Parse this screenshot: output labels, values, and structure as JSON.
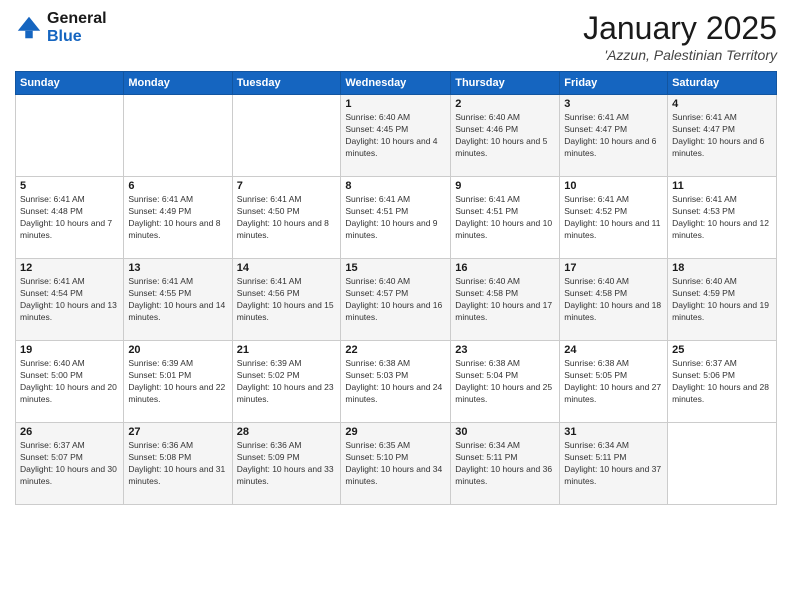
{
  "logo": {
    "line1": "General",
    "line2": "Blue"
  },
  "title": "January 2025",
  "location": "'Azzun, Palestinian Territory",
  "weekdays": [
    "Sunday",
    "Monday",
    "Tuesday",
    "Wednesday",
    "Thursday",
    "Friday",
    "Saturday"
  ],
  "weeks": [
    [
      {
        "day": "",
        "sunrise": "",
        "sunset": "",
        "daylight": ""
      },
      {
        "day": "",
        "sunrise": "",
        "sunset": "",
        "daylight": ""
      },
      {
        "day": "",
        "sunrise": "",
        "sunset": "",
        "daylight": ""
      },
      {
        "day": "1",
        "sunrise": "Sunrise: 6:40 AM",
        "sunset": "Sunset: 4:45 PM",
        "daylight": "Daylight: 10 hours and 4 minutes."
      },
      {
        "day": "2",
        "sunrise": "Sunrise: 6:40 AM",
        "sunset": "Sunset: 4:46 PM",
        "daylight": "Daylight: 10 hours and 5 minutes."
      },
      {
        "day": "3",
        "sunrise": "Sunrise: 6:41 AM",
        "sunset": "Sunset: 4:47 PM",
        "daylight": "Daylight: 10 hours and 6 minutes."
      },
      {
        "day": "4",
        "sunrise": "Sunrise: 6:41 AM",
        "sunset": "Sunset: 4:47 PM",
        "daylight": "Daylight: 10 hours and 6 minutes."
      }
    ],
    [
      {
        "day": "5",
        "sunrise": "Sunrise: 6:41 AM",
        "sunset": "Sunset: 4:48 PM",
        "daylight": "Daylight: 10 hours and 7 minutes."
      },
      {
        "day": "6",
        "sunrise": "Sunrise: 6:41 AM",
        "sunset": "Sunset: 4:49 PM",
        "daylight": "Daylight: 10 hours and 8 minutes."
      },
      {
        "day": "7",
        "sunrise": "Sunrise: 6:41 AM",
        "sunset": "Sunset: 4:50 PM",
        "daylight": "Daylight: 10 hours and 8 minutes."
      },
      {
        "day": "8",
        "sunrise": "Sunrise: 6:41 AM",
        "sunset": "Sunset: 4:51 PM",
        "daylight": "Daylight: 10 hours and 9 minutes."
      },
      {
        "day": "9",
        "sunrise": "Sunrise: 6:41 AM",
        "sunset": "Sunset: 4:51 PM",
        "daylight": "Daylight: 10 hours and 10 minutes."
      },
      {
        "day": "10",
        "sunrise": "Sunrise: 6:41 AM",
        "sunset": "Sunset: 4:52 PM",
        "daylight": "Daylight: 10 hours and 11 minutes."
      },
      {
        "day": "11",
        "sunrise": "Sunrise: 6:41 AM",
        "sunset": "Sunset: 4:53 PM",
        "daylight": "Daylight: 10 hours and 12 minutes."
      }
    ],
    [
      {
        "day": "12",
        "sunrise": "Sunrise: 6:41 AM",
        "sunset": "Sunset: 4:54 PM",
        "daylight": "Daylight: 10 hours and 13 minutes."
      },
      {
        "day": "13",
        "sunrise": "Sunrise: 6:41 AM",
        "sunset": "Sunset: 4:55 PM",
        "daylight": "Daylight: 10 hours and 14 minutes."
      },
      {
        "day": "14",
        "sunrise": "Sunrise: 6:41 AM",
        "sunset": "Sunset: 4:56 PM",
        "daylight": "Daylight: 10 hours and 15 minutes."
      },
      {
        "day": "15",
        "sunrise": "Sunrise: 6:40 AM",
        "sunset": "Sunset: 4:57 PM",
        "daylight": "Daylight: 10 hours and 16 minutes."
      },
      {
        "day": "16",
        "sunrise": "Sunrise: 6:40 AM",
        "sunset": "Sunset: 4:58 PM",
        "daylight": "Daylight: 10 hours and 17 minutes."
      },
      {
        "day": "17",
        "sunrise": "Sunrise: 6:40 AM",
        "sunset": "Sunset: 4:58 PM",
        "daylight": "Daylight: 10 hours and 18 minutes."
      },
      {
        "day": "18",
        "sunrise": "Sunrise: 6:40 AM",
        "sunset": "Sunset: 4:59 PM",
        "daylight": "Daylight: 10 hours and 19 minutes."
      }
    ],
    [
      {
        "day": "19",
        "sunrise": "Sunrise: 6:40 AM",
        "sunset": "Sunset: 5:00 PM",
        "daylight": "Daylight: 10 hours and 20 minutes."
      },
      {
        "day": "20",
        "sunrise": "Sunrise: 6:39 AM",
        "sunset": "Sunset: 5:01 PM",
        "daylight": "Daylight: 10 hours and 22 minutes."
      },
      {
        "day": "21",
        "sunrise": "Sunrise: 6:39 AM",
        "sunset": "Sunset: 5:02 PM",
        "daylight": "Daylight: 10 hours and 23 minutes."
      },
      {
        "day": "22",
        "sunrise": "Sunrise: 6:38 AM",
        "sunset": "Sunset: 5:03 PM",
        "daylight": "Daylight: 10 hours and 24 minutes."
      },
      {
        "day": "23",
        "sunrise": "Sunrise: 6:38 AM",
        "sunset": "Sunset: 5:04 PM",
        "daylight": "Daylight: 10 hours and 25 minutes."
      },
      {
        "day": "24",
        "sunrise": "Sunrise: 6:38 AM",
        "sunset": "Sunset: 5:05 PM",
        "daylight": "Daylight: 10 hours and 27 minutes."
      },
      {
        "day": "25",
        "sunrise": "Sunrise: 6:37 AM",
        "sunset": "Sunset: 5:06 PM",
        "daylight": "Daylight: 10 hours and 28 minutes."
      }
    ],
    [
      {
        "day": "26",
        "sunrise": "Sunrise: 6:37 AM",
        "sunset": "Sunset: 5:07 PM",
        "daylight": "Daylight: 10 hours and 30 minutes."
      },
      {
        "day": "27",
        "sunrise": "Sunrise: 6:36 AM",
        "sunset": "Sunset: 5:08 PM",
        "daylight": "Daylight: 10 hours and 31 minutes."
      },
      {
        "day": "28",
        "sunrise": "Sunrise: 6:36 AM",
        "sunset": "Sunset: 5:09 PM",
        "daylight": "Daylight: 10 hours and 33 minutes."
      },
      {
        "day": "29",
        "sunrise": "Sunrise: 6:35 AM",
        "sunset": "Sunset: 5:10 PM",
        "daylight": "Daylight: 10 hours and 34 minutes."
      },
      {
        "day": "30",
        "sunrise": "Sunrise: 6:34 AM",
        "sunset": "Sunset: 5:11 PM",
        "daylight": "Daylight: 10 hours and 36 minutes."
      },
      {
        "day": "31",
        "sunrise": "Sunrise: 6:34 AM",
        "sunset": "Sunset: 5:11 PM",
        "daylight": "Daylight: 10 hours and 37 minutes."
      },
      {
        "day": "",
        "sunrise": "",
        "sunset": "",
        "daylight": ""
      }
    ]
  ]
}
